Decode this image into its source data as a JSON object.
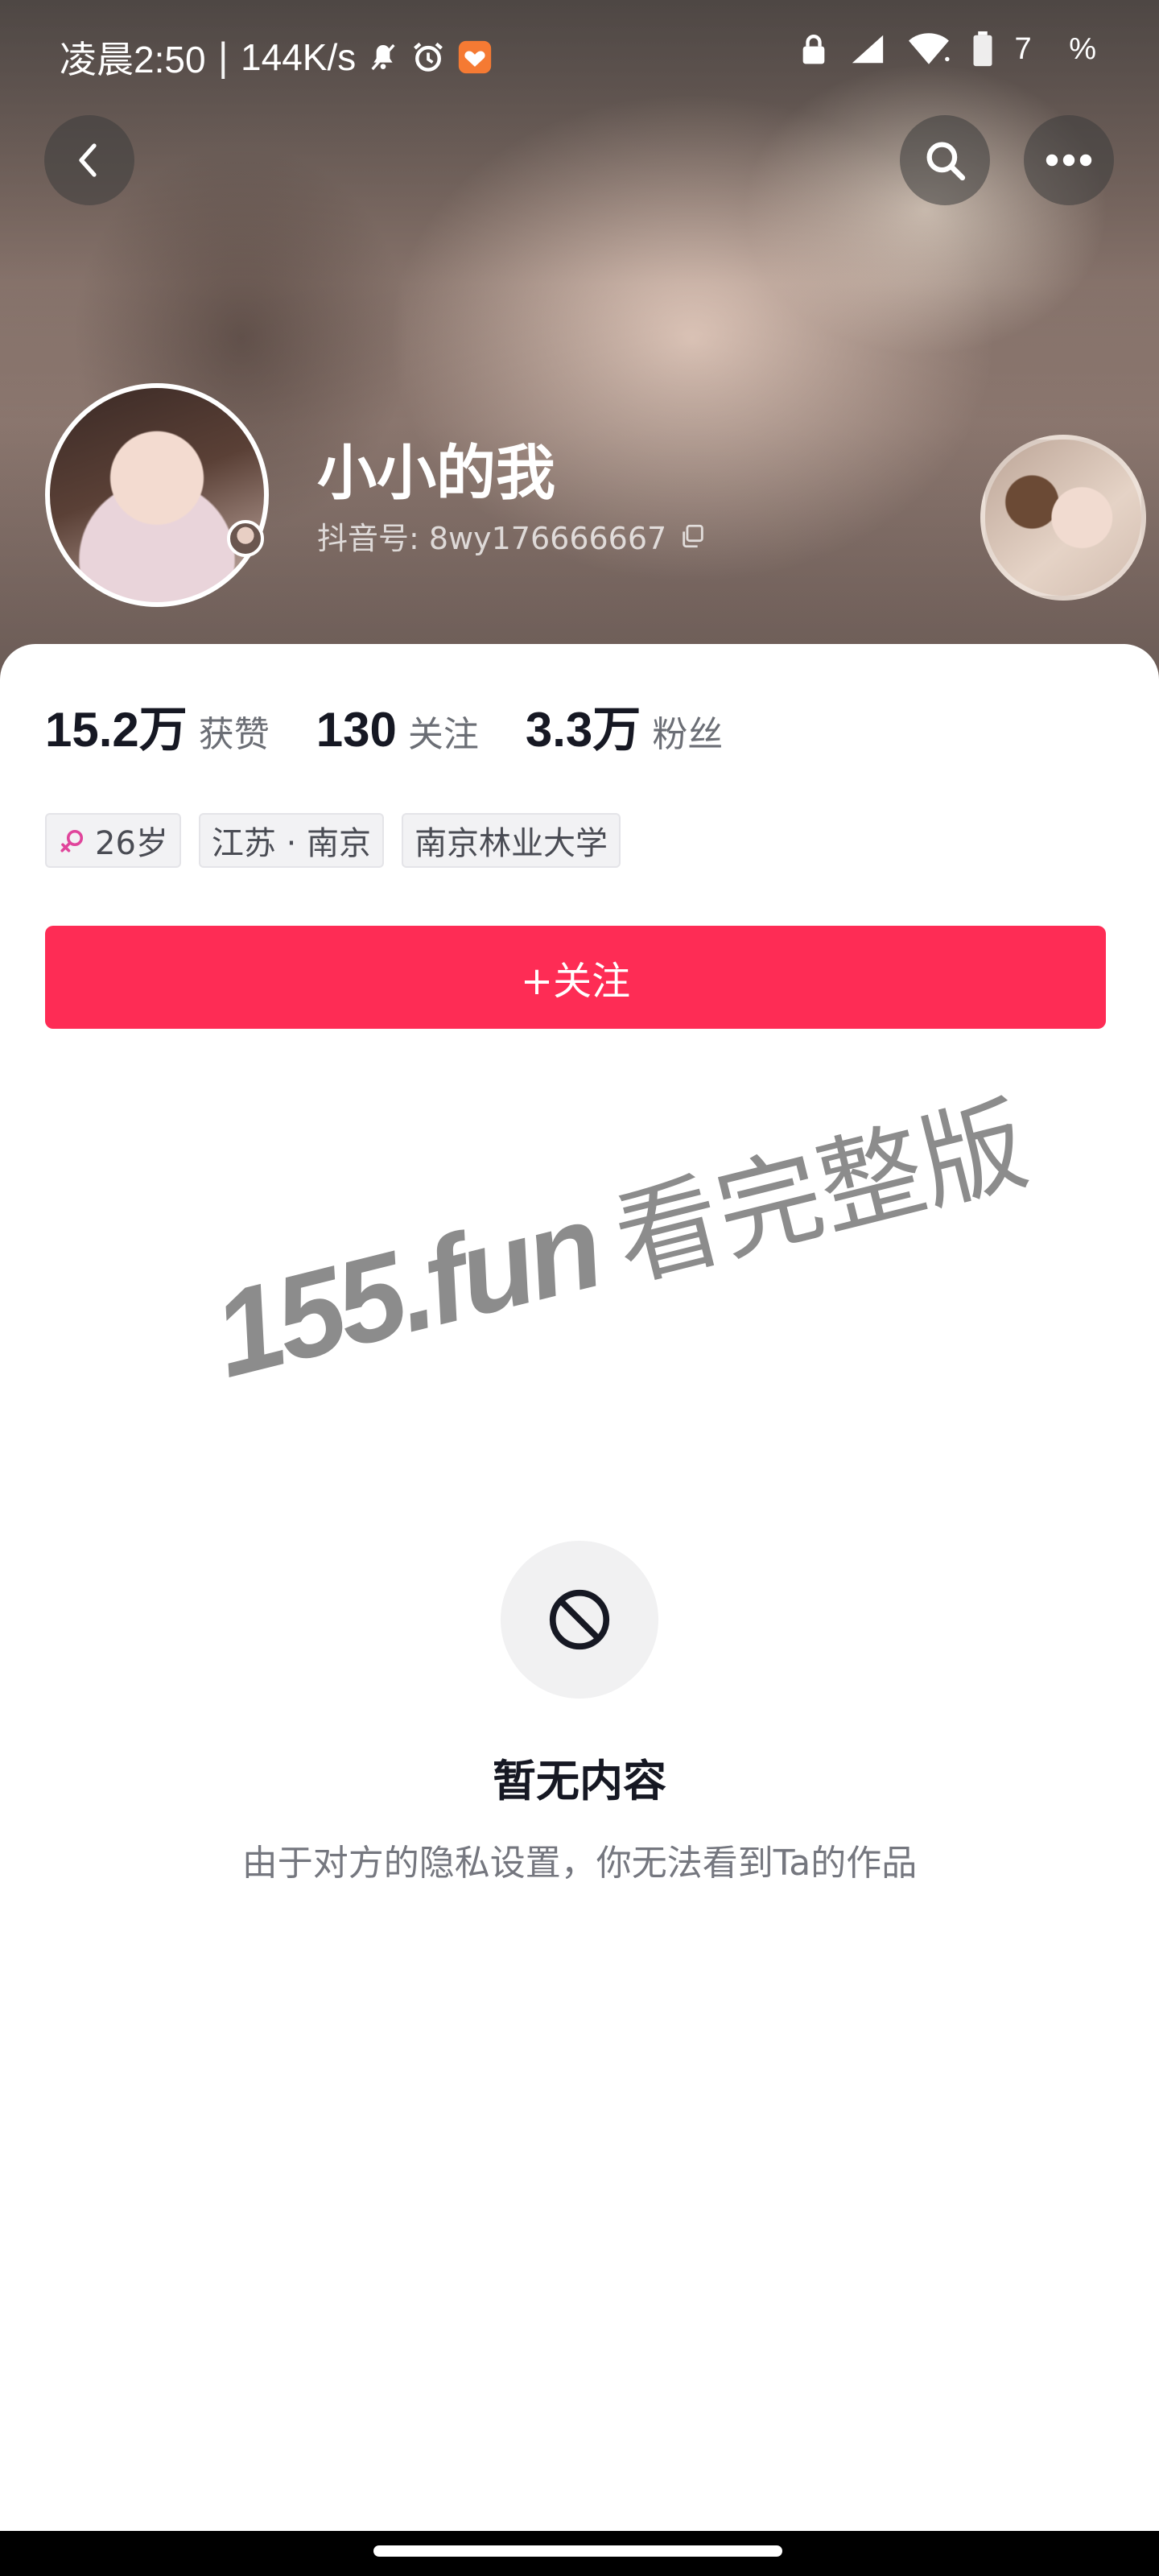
{
  "status_bar": {
    "time": "凌晨2:50",
    "separator": "|",
    "network_speed": "144K/s",
    "battery_text": "7 %"
  },
  "profile": {
    "nickname": "小小的我",
    "douyin_id": "抖音号: 8wy176666667"
  },
  "stats": [
    {
      "value": "15.2万",
      "label": "获赞"
    },
    {
      "value": "130",
      "label": "关注"
    },
    {
      "value": "3.3万",
      "label": "粉丝"
    }
  ],
  "tags": {
    "age": "26岁",
    "location": "江苏 · 南京",
    "school": "南京林业大学"
  },
  "follow_button": {
    "label": "+关注"
  },
  "watermark": {
    "domain": "155.fun",
    "text": "看完整版"
  },
  "empty_state": {
    "title": "暂无内容",
    "description": "由于对方的隐私设置，你无法看到Ta的作品"
  },
  "colors": {
    "accent": "#fe2c55",
    "gender_icon": "#e0459b"
  },
  "icons": {
    "back": "chevron-left-icon",
    "search": "search-icon",
    "more": "more-horizontal-icon",
    "copy": "copy-icon",
    "empty": "prohibited-icon",
    "gender": "female-icon"
  }
}
